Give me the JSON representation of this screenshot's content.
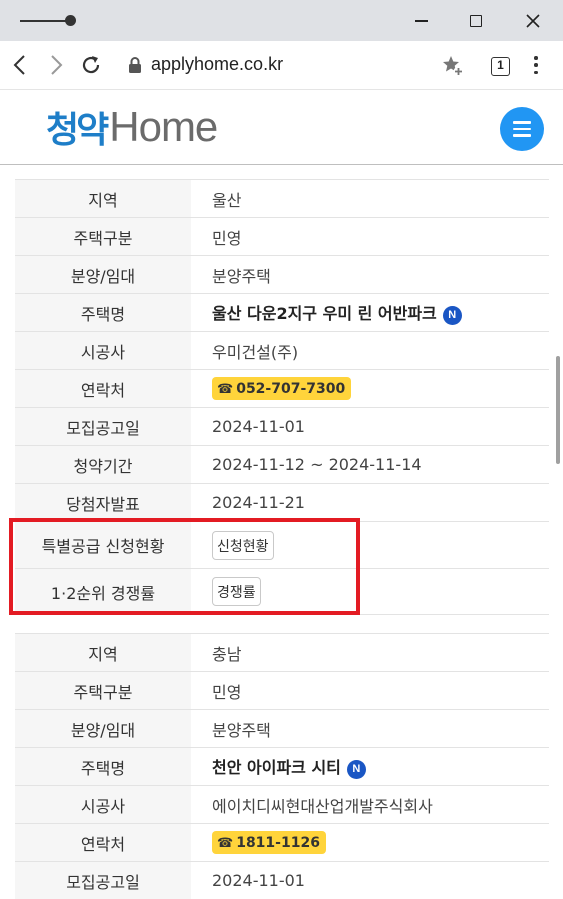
{
  "browser": {
    "url": "applyhome.co.kr",
    "tab_count": "1"
  },
  "site": {
    "logo_korean": "청약",
    "logo_english": "Home"
  },
  "listing1": {
    "rows": [
      {
        "label": "지역",
        "value": "울산"
      },
      {
        "label": "주택구분",
        "value": "민영"
      },
      {
        "label": "분양/임대",
        "value": "분양주택"
      },
      {
        "label": "주택명",
        "value": "울산 다운2지구 우미 린 어반파크",
        "badge": "N"
      },
      {
        "label": "시공사",
        "value": "우미건설(주)"
      },
      {
        "label": "연락처",
        "value": "052-707-7300"
      },
      {
        "label": "모집공고일",
        "value": "2024-11-01"
      },
      {
        "label": "청약기간",
        "value": "2024-11-12 ~ 2024-11-14"
      },
      {
        "label": "당첨자발표",
        "value": "2024-11-21"
      },
      {
        "label": "특별공급 신청현황",
        "value": "신청현황"
      },
      {
        "label": "1·2순위 경쟁률",
        "value": "경쟁률"
      }
    ]
  },
  "listing2": {
    "rows": [
      {
        "label": "지역",
        "value": "충남"
      },
      {
        "label": "주택구분",
        "value": "민영"
      },
      {
        "label": "분양/임대",
        "value": "분양주택"
      },
      {
        "label": "주택명",
        "value": "천안 아이파크 시티",
        "badge": "N"
      },
      {
        "label": "시공사",
        "value": "에이치디씨현대산업개발주식회사"
      },
      {
        "label": "연락처",
        "value": "1811-1126"
      },
      {
        "label": "모집공고일",
        "value": "2024-11-01"
      }
    ]
  },
  "colors": {
    "highlight": "#e31b23",
    "phone_badge": "#ffd43b",
    "new_badge": "#1a56c4",
    "menu_button": "#2196f3"
  }
}
